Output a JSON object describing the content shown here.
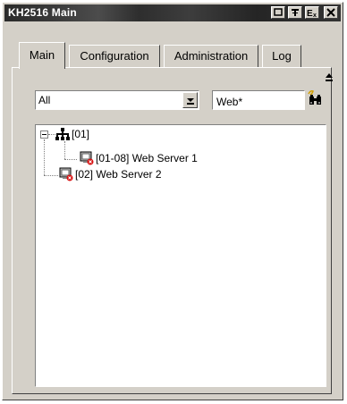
{
  "window": {
    "title": "KH2516 Main",
    "buttons": [
      "□",
      "T",
      "Ex",
      "✕"
    ]
  },
  "tabs": [
    {
      "label": "Main",
      "active": true
    },
    {
      "label": "Configuration",
      "active": false
    },
    {
      "label": "Administration",
      "active": false
    },
    {
      "label": "Log",
      "active": false
    }
  ],
  "filter": {
    "selected": "All"
  },
  "search": {
    "value": "Web*"
  },
  "tree": {
    "root": {
      "label": "[01]",
      "icon": "network-tree-icon",
      "expanded": true
    },
    "child": {
      "label": "[01-08]  Web Server 1",
      "icon": "server-port-icon"
    },
    "sibling": {
      "label": "[02]  Web Server 2",
      "icon": "server-port-icon"
    }
  },
  "colors": {
    "window_bg": "#d4d0c8",
    "titlebar": "#333333",
    "port_icon_red": "#d81010"
  }
}
